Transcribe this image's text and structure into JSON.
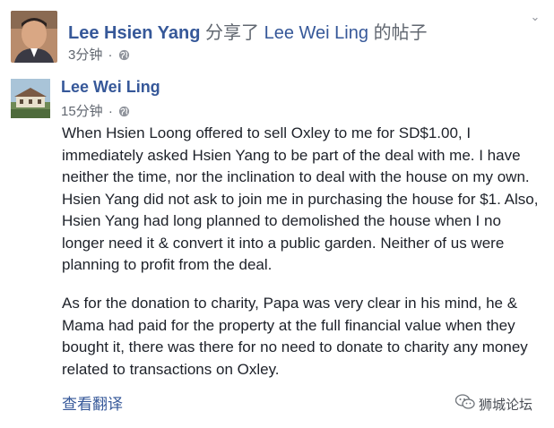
{
  "share_header": {
    "sharer_name": "Lee Hsien Yang",
    "action_text": "分享了",
    "shared_from_name": "Lee Wei Ling",
    "post_word": "的帖子",
    "time": "3分钟",
    "separator": "·"
  },
  "post": {
    "author_name": "Lee Wei Ling",
    "time": "15分钟",
    "separator": "·",
    "paragraphs": [
      "When Hsien Loong offered to sell Oxley to me for SD$1.00, I immediately asked Hsien Yang to be part of the deal with me. I have neither the time, nor the inclination to deal with the house on my own. Hsien Yang did not ask to join me in purchasing the house for $1. Also, Hsien Yang had long planned to demolished the house when I no longer need it & convert it into a public garden. Neither of us were planning to profit from the deal.",
      "As for the donation to charity, Papa was very clear in his mind, he & Mama had paid for the property at the full financial value when they bought it, there was there for no need to donate to charity any money related to transactions on Oxley."
    ],
    "see_translation": "查看翻译"
  },
  "watermark": {
    "text": "狮城论坛",
    "icon": "wechat-icon"
  },
  "icons": {
    "privacy": "globe-icon",
    "menu": "chevron-down-icon"
  },
  "colors": {
    "link": "#365899",
    "meta": "#616770",
    "text": "#1d2129"
  }
}
